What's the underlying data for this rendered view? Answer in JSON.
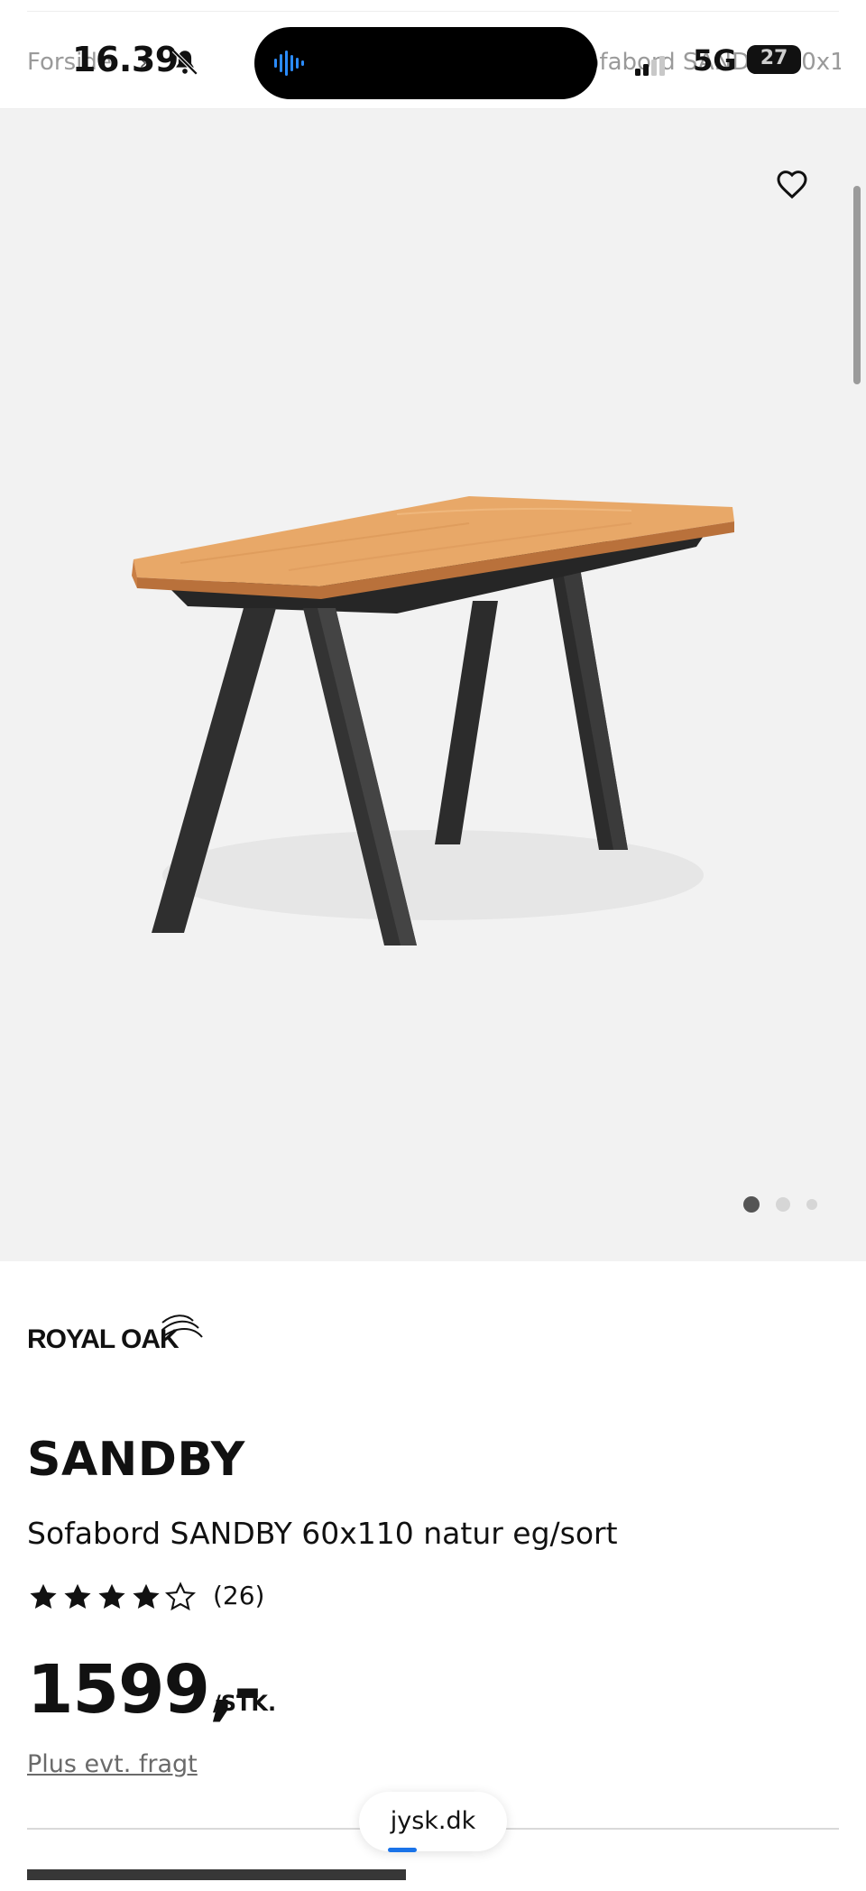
{
  "status_bar": {
    "time": "16.39",
    "network": "5G",
    "battery": "27",
    "icons": [
      "bell-slash-icon",
      "audio-wave-icon",
      "signal-icon",
      "battery-icon"
    ]
  },
  "breadcrumb": {
    "left": "Forside",
    "separator": "›",
    "right": "Sofabord SANDBY 60x110"
  },
  "gallery": {
    "favorite_icon": "heart-icon",
    "image_alt": "Sofabord SANDBY 60x110 natur eg/sort",
    "slide_count": 3,
    "active_slide": 1
  },
  "product": {
    "brand": "ROYAL OAK",
    "name": "SANDBY",
    "description": "Sofabord SANDBY 60x110 natur eg/sort",
    "rating_value": 4,
    "rating_max": 5,
    "rating_count": "(26)",
    "price": "1599,-",
    "price_unit": "/STK.",
    "shipping_note": "Plus evt. fragt"
  },
  "browser": {
    "url": "jysk.dk"
  },
  "colors": {
    "gallery_bg": "#f2f2f2",
    "text": "#111111",
    "muted": "#6a6a6a",
    "accent_progress": "#1a73e8"
  }
}
